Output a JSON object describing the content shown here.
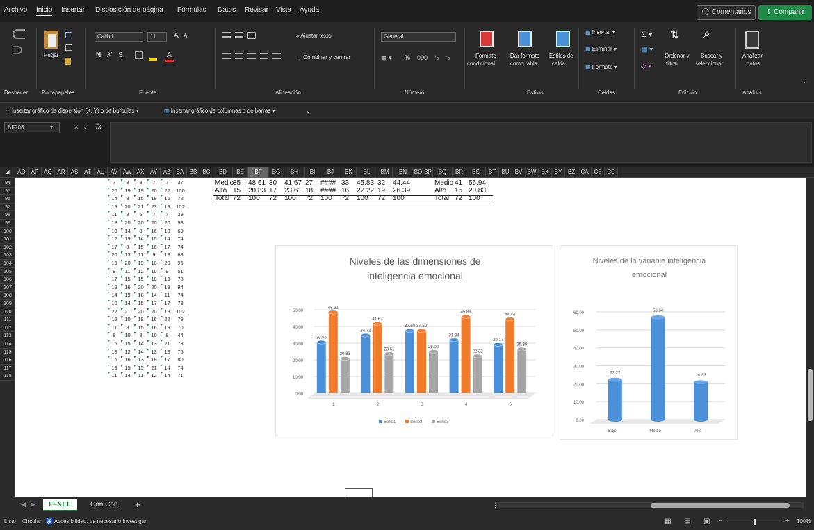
{
  "menu": {
    "items": [
      "Archivo",
      "Inicio",
      "Insertar",
      "Disposición de página",
      "Fórmulas",
      "Datos",
      "Revisar",
      "Vista",
      "Ayuda"
    ],
    "active": "Inicio",
    "comments": "Comentarios",
    "share": "Compartir"
  },
  "ribbon": {
    "undo_label": "Deshacer",
    "clipboard_label": "Portapapeles",
    "paste": "Pegar",
    "font_name": "Calibri",
    "font_size": "11",
    "font_label": "Fuente",
    "wrap_text": "Ajustar texto",
    "merge_center": "Combinar y centrar",
    "alignment_label": "Alineación",
    "number_format": "General",
    "number_label": "Número",
    "conditional_format": [
      "Formato",
      "condicional"
    ],
    "format_table": [
      "Dar formato",
      "como tabla"
    ],
    "cell_styles": [
      "Estilos de",
      "celda"
    ],
    "styles_label": "Estilos",
    "insert": "Insertar",
    "delete": "Eliminar",
    "format": "Formato",
    "cells_label": "Celdas",
    "sort_filter": [
      "Ordenar y",
      "filtrar"
    ],
    "find_select": [
      "Buscar y",
      "seleccionar"
    ],
    "edit_label": "Edición",
    "analyze": [
      "Analizar",
      "datos"
    ],
    "analysis_label": "Análisis"
  },
  "quickbar": {
    "scatter": "Insertar gráfico de dispersión (X, Y) o de burbujas",
    "column": "Insertar gráfico de columnas o de barras"
  },
  "formula": {
    "namebox": "BF208",
    "fx": "fx"
  },
  "columns": [
    "AO",
    "AP",
    "AQ",
    "AR",
    "AS",
    "AT",
    "AU",
    "AV",
    "AW",
    "AX",
    "AY",
    "AZ",
    "BA",
    "BB",
    "BC",
    "BD",
    "BE",
    "BF",
    "BG",
    "BH",
    "BI",
    "BJ",
    "BK",
    "BL",
    "BM",
    "BN",
    "BO",
    "BP",
    "BQ",
    "BR",
    "BS",
    "BT",
    "BU",
    "BV",
    "BW",
    "BX",
    "BY",
    "BZ",
    "CA",
    "CB",
    "CC"
  ],
  "selected_column": "BF",
  "rows": [
    "94",
    "95",
    "96",
    "97",
    "98",
    "99",
    "100",
    "101",
    "102",
    "103",
    "104",
    "105",
    "106",
    "107",
    "108",
    "109",
    "110",
    "111",
    "112",
    "113",
    "114",
    "115",
    "116",
    "117",
    "118"
  ],
  "left_data": [
    [
      "7",
      "8",
      "8",
      "7",
      "7",
      "37"
    ],
    [
      "20",
      "19",
      "19",
      "20",
      "22",
      "100"
    ],
    [
      "14",
      "8",
      "15",
      "18",
      "16",
      "72"
    ],
    [
      "19",
      "20",
      "21",
      "23",
      "19",
      "102"
    ],
    [
      "11",
      "8",
      "6",
      "7",
      "7",
      "39"
    ],
    [
      "18",
      "20",
      "20",
      "20",
      "20",
      "98"
    ],
    [
      "18",
      "14",
      "8",
      "16",
      "13",
      "69"
    ],
    [
      "12",
      "19",
      "14",
      "15",
      "14",
      "74"
    ],
    [
      "17",
      "8",
      "15",
      "16",
      "17",
      "74"
    ],
    [
      "20",
      "13",
      "11",
      "9",
      "13",
      "68"
    ],
    [
      "19",
      "20",
      "19",
      "18",
      "20",
      "96"
    ],
    [
      "9",
      "11",
      "12",
      "10",
      "9",
      "51"
    ],
    [
      "17",
      "15",
      "15",
      "18",
      "13",
      "78"
    ],
    [
      "19",
      "16",
      "20",
      "20",
      "19",
      "94"
    ],
    [
      "14",
      "19",
      "18",
      "14",
      "11",
      "74"
    ],
    [
      "10",
      "14",
      "15",
      "17",
      "17",
      "73"
    ],
    [
      "22",
      "21",
      "20",
      "20",
      "19",
      "102"
    ],
    [
      "12",
      "10",
      "18",
      "16",
      "22",
      "79"
    ],
    [
      "11",
      "8",
      "15",
      "16",
      "19",
      "70"
    ],
    [
      "8",
      "10",
      "8",
      "10",
      "8",
      "44"
    ],
    [
      "15",
      "15",
      "14",
      "13",
      "21",
      "78"
    ],
    [
      "18",
      "12",
      "14",
      "13",
      "18",
      "75"
    ],
    [
      "16",
      "16",
      "13",
      "18",
      "17",
      "80"
    ],
    [
      "13",
      "15",
      "15",
      "21",
      "14",
      "74"
    ],
    [
      "11",
      "14",
      "11",
      "12",
      "14",
      "71"
    ]
  ],
  "summary_table": [
    [
      "Medio",
      "35",
      "48.61",
      "30",
      "41.67",
      "27",
      "####",
      "33",
      "45.83",
      "32",
      "44.44"
    ],
    [
      "Alto",
      "15",
      "20.83",
      "17",
      "23.61",
      "18",
      "####",
      "16",
      "22.22",
      "19",
      "26.39"
    ],
    [
      "Total",
      "72",
      "100",
      "72",
      "100",
      "72",
      "100",
      "72",
      "100",
      "72",
      "100"
    ]
  ],
  "summary_table2": [
    [
      "Medio",
      "41",
      "56.94"
    ],
    [
      "Alto",
      "15",
      "20.83"
    ],
    [
      "Total",
      "72",
      "100"
    ]
  ],
  "chart_data": [
    {
      "type": "bar",
      "title": "Niveles de las dimensiones de inteligencia emocional",
      "categories": [
        "1",
        "2",
        "3",
        "4",
        "5"
      ],
      "series": [
        {
          "name": "Serie1",
          "values": [
            30.56,
            34.72,
            37.5,
            31.94,
            29.17
          ]
        },
        {
          "name": "Serie2",
          "values": [
            48.61,
            41.67,
            37.5,
            45.83,
            44.44
          ]
        },
        {
          "name": "Serie3",
          "values": [
            20.83,
            23.61,
            25.0,
            22.22,
            26.39
          ]
        }
      ],
      "labels": [
        [
          "30.56",
          "34.72",
          "37.50",
          "31.94",
          "29.17"
        ],
        [
          "48.61",
          "41.67",
          "37.50",
          "45.83",
          "44.44"
        ],
        [
          "20.83",
          "23.61",
          "25.00",
          "22.22",
          "26.39"
        ]
      ],
      "yticks": [
        "0.00",
        "10.00",
        "20.00",
        "30.00",
        "40.00",
        "50.00"
      ],
      "ylim": [
        0,
        50
      ],
      "legend": "bottom",
      "grid": true
    },
    {
      "type": "bar",
      "title": "Niveles de la variable inteligencia emocional",
      "categories": [
        "Bajo",
        "Medio",
        "Alto"
      ],
      "values": [
        22.22,
        56.94,
        20.83
      ],
      "labels": [
        "22.22",
        "56.94",
        "20.83"
      ],
      "yticks": [
        "0.00",
        "10.00",
        "20.00",
        "30.00",
        "40.00",
        "50.00",
        "60.00"
      ],
      "ylim": [
        0,
        60
      ],
      "grid": true
    }
  ],
  "colors": {
    "series1": "#4a90d9",
    "series2": "#f07b2a",
    "series3": "#a6a6a6",
    "share": "#1f8a48"
  },
  "tabs": {
    "active": "FF&EE",
    "other": "Con Con",
    "add": "+"
  },
  "status": {
    "ready": "Listo",
    "circular": "Circular",
    "accessibility": "Accesibilidad: es necesario investigar",
    "zoom": "100%"
  }
}
